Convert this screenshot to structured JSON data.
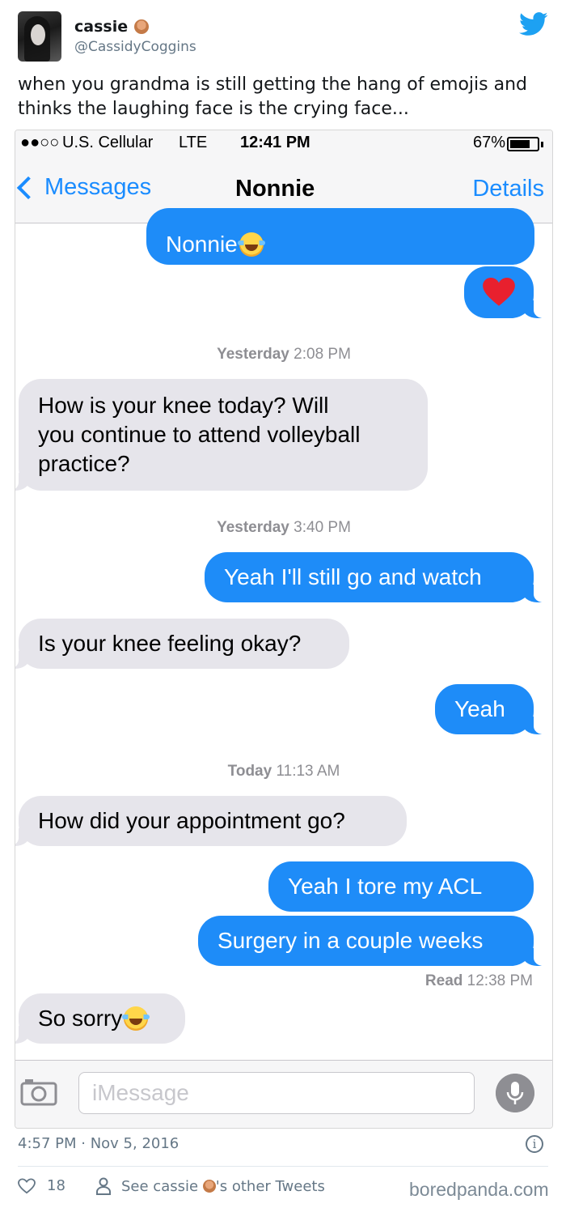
{
  "tweet": {
    "author_name": "cassie",
    "author_handle": "@CassidyCoggins",
    "text": "when you grandma is still getting the hang of emojis and thinks the laughing face is the crying face...",
    "timestamp": "4:57 PM · Nov 5, 2016",
    "likes": "18",
    "see_other_prefix": "See cassie",
    "see_other_suffix": "'s other Tweets",
    "watermark": "boredpanda.com"
  },
  "phone": {
    "status": {
      "signal": "●●○○",
      "carrier": "U.S. Cellular",
      "network": "LTE",
      "time": "12:41 PM",
      "battery": "67%"
    },
    "nav": {
      "back_label": "Messages",
      "title": "Nonnie",
      "details_label": "Details"
    },
    "messages": [
      {
        "dir": "out",
        "text": "Nonnie",
        "emoji": "laughing-crying"
      },
      {
        "dir": "out",
        "emoji": "red-heart"
      },
      {
        "stamp_day": "Yesterday",
        "stamp_time": "2:08 PM"
      },
      {
        "dir": "in",
        "lines": [
          "How is your knee today?  Will",
          "you continue to attend volleyball",
          "practice?"
        ]
      },
      {
        "stamp_day": "Yesterday",
        "stamp_time": "3:40 PM"
      },
      {
        "dir": "out",
        "text": "Yeah I'll still go and watch"
      },
      {
        "dir": "in",
        "text": "Is your knee feeling okay?"
      },
      {
        "dir": "out",
        "text": "Yeah"
      },
      {
        "stamp_day": "Today",
        "stamp_time": "11:13 AM"
      },
      {
        "dir": "in",
        "text": "How did your appointment go?"
      },
      {
        "dir": "out",
        "text": "Yeah I tore my ACL"
      },
      {
        "dir": "out",
        "text": "Surgery in a couple weeks"
      },
      {
        "read_label": "Read",
        "read_time": "12:38 PM"
      },
      {
        "dir": "in",
        "text": "So sorry",
        "emoji": "laughing-crying"
      }
    ],
    "input": {
      "placeholder": "iMessage"
    }
  },
  "colors": {
    "ios_blue": "#1e8cf8",
    "incoming_gray": "#e6e5eb",
    "twitter_blue": "#1da1f2",
    "meta_gray": "#657786"
  },
  "icons": [
    "twitter-bird-icon",
    "camera-icon",
    "microphone-icon",
    "info-icon",
    "heart-outline-icon",
    "person-outline-icon",
    "back-chevron-icon"
  ]
}
